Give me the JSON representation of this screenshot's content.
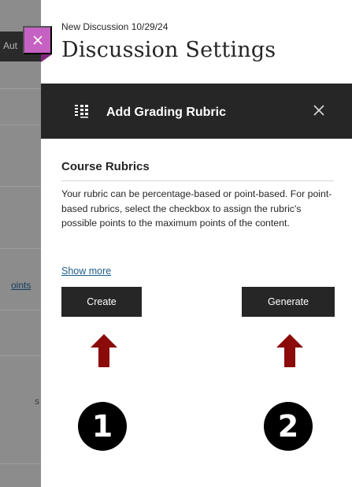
{
  "background": {
    "topbar_text": "Aut",
    "points_link": "oints",
    "side_letter": "s"
  },
  "panel": {
    "close_icon": "close-icon",
    "breadcrumb": "New Discussion 10/29/24",
    "title": "Discussion Settings"
  },
  "rubric": {
    "icon": "rubric-grid-icon",
    "header_title": "Add Grading Rubric",
    "close_icon": "close-icon",
    "section_heading": "Course Rubrics",
    "description": "Your rubric can be percentage-based or point-based. For point-based rubrics, select the checkbox to assign the rubric's possible points to the maximum points of the content.",
    "show_more": "Show more",
    "create_label": "Create",
    "generate_label": "Generate"
  },
  "annotations": {
    "arrow_color": "#8b0a0a",
    "badge_1": "1",
    "badge_2": "2"
  },
  "colors": {
    "accent_close": "#c561c2",
    "header_bar": "#262626",
    "link": "#1b5c8a"
  }
}
